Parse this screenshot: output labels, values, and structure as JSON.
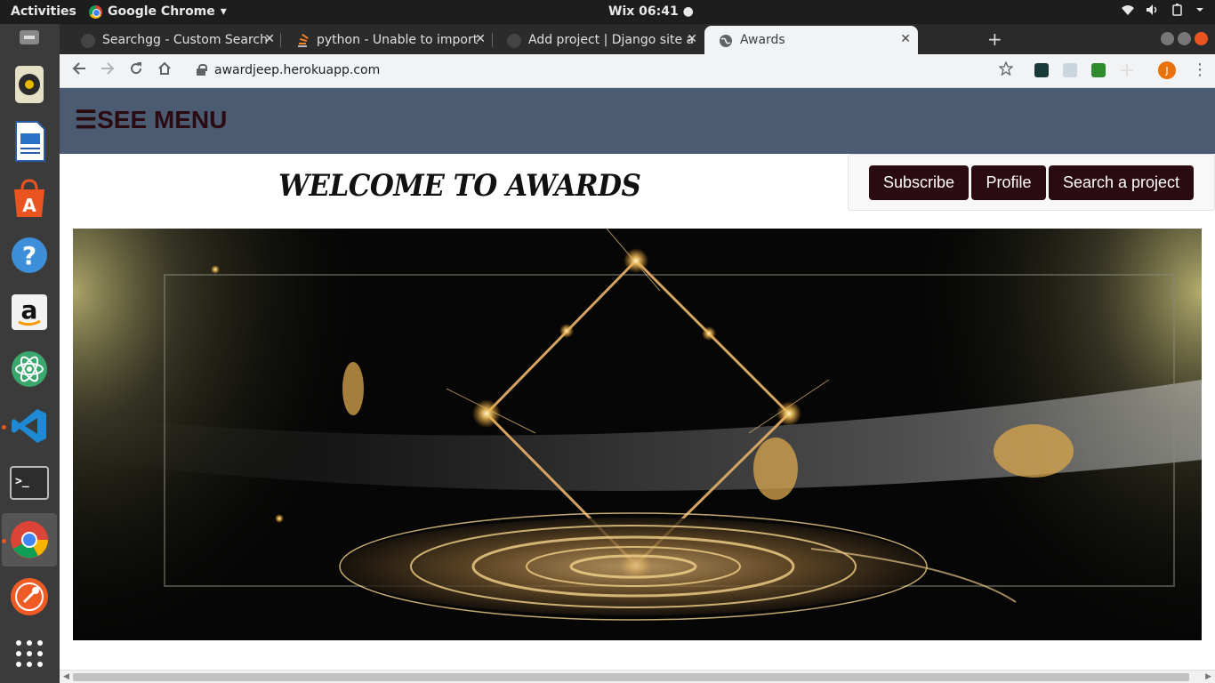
{
  "system_bar": {
    "activities": "Activities",
    "app_name": "Google Chrome",
    "app_caret": "▾",
    "clock": "Wix 06:41 ●"
  },
  "browser": {
    "tabs": [
      {
        "title": "Searchgg - Custom Search"
      },
      {
        "title": "python - Unable to import"
      },
      {
        "title": "Add project | Django site a"
      },
      {
        "title": "Awards"
      }
    ],
    "url": "awardjeep.herokuapp.com",
    "profile_initial": "J"
  },
  "page": {
    "menu_label": "☰SEE MENU",
    "heading": "WELCOME TO AWARDS",
    "buttons": {
      "subscribe": "Subscribe",
      "profile": "Profile",
      "search": "Search a project"
    }
  },
  "colors": {
    "navbar": "#4b5b72",
    "button_bg": "#2b0b12",
    "menu_text": "#2b0b12"
  }
}
